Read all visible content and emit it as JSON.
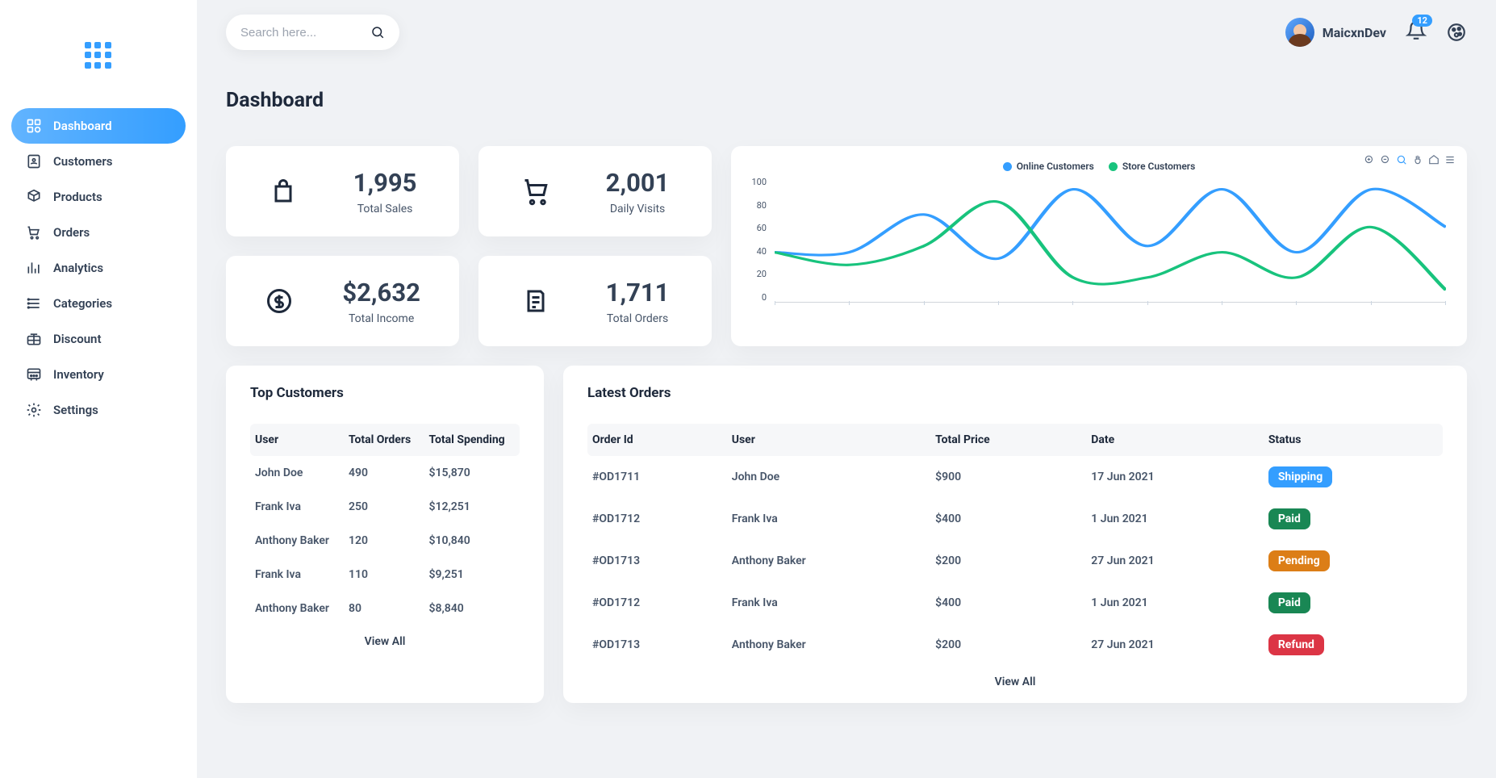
{
  "header": {
    "search_placeholder": "Search here...",
    "user_name": "MaicxnDev",
    "notification_count": "12"
  },
  "page": {
    "title": "Dashboard"
  },
  "sidebar": {
    "items": [
      {
        "label": "Dashboard"
      },
      {
        "label": "Customers"
      },
      {
        "label": "Products"
      },
      {
        "label": "Orders"
      },
      {
        "label": "Analytics"
      },
      {
        "label": "Categories"
      },
      {
        "label": "Discount"
      },
      {
        "label": "Inventory"
      },
      {
        "label": "Settings"
      }
    ]
  },
  "stats": [
    {
      "value": "1,995",
      "label": "Total Sales"
    },
    {
      "value": "2,001",
      "label": "Daily Visits"
    },
    {
      "value": "$2,632",
      "label": "Total Income"
    },
    {
      "value": "1,711",
      "label": "Total Orders"
    }
  ],
  "chart_data": {
    "type": "line",
    "ylim": [
      0,
      100
    ],
    "yticks": [
      "100",
      "80",
      "60",
      "40",
      "20",
      "0"
    ],
    "x": [
      1,
      2,
      3,
      4,
      5,
      6,
      7,
      8,
      9,
      10
    ],
    "series": [
      {
        "name": "Online Customers",
        "color": "#349EFF",
        "values": [
          40,
          40,
          70,
          35,
          90,
          45,
          90,
          40,
          90,
          60
        ]
      },
      {
        "name": "Store Customers",
        "color": "#18c37d",
        "values": [
          40,
          30,
          45,
          80,
          20,
          20,
          40,
          20,
          60,
          10
        ]
      }
    ]
  },
  "chart_toolbar": [
    "zoom-in",
    "zoom-out",
    "zoom",
    "pan",
    "home",
    "menu"
  ],
  "top_customers": {
    "title": "Top Customers",
    "columns": [
      "User",
      "Total Orders",
      "Total Spending"
    ],
    "rows": [
      [
        "John Doe",
        "490",
        "$15,870"
      ],
      [
        "Frank Iva",
        "250",
        "$12,251"
      ],
      [
        "Anthony Baker",
        "120",
        "$10,840"
      ],
      [
        "Frank Iva",
        "110",
        "$9,251"
      ],
      [
        "Anthony Baker",
        "80",
        "$8,840"
      ]
    ],
    "view_all": "View All"
  },
  "latest_orders": {
    "title": "Latest Orders",
    "columns": [
      "Order Id",
      "User",
      "Total Price",
      "Date",
      "Status"
    ],
    "rows": [
      [
        "#OD1711",
        "John Doe",
        "$900",
        "17 Jun 2021",
        "Shipping"
      ],
      [
        "#OD1712",
        "Frank Iva",
        "$400",
        "1 Jun 2021",
        "Paid"
      ],
      [
        "#OD1713",
        "Anthony Baker",
        "$200",
        "27 Jun 2021",
        "Pending"
      ],
      [
        "#OD1712",
        "Frank Iva",
        "$400",
        "1 Jun 2021",
        "Paid"
      ],
      [
        "#OD1713",
        "Anthony Baker",
        "$200",
        "27 Jun 2021",
        "Refund"
      ]
    ],
    "view_all": "View All"
  }
}
